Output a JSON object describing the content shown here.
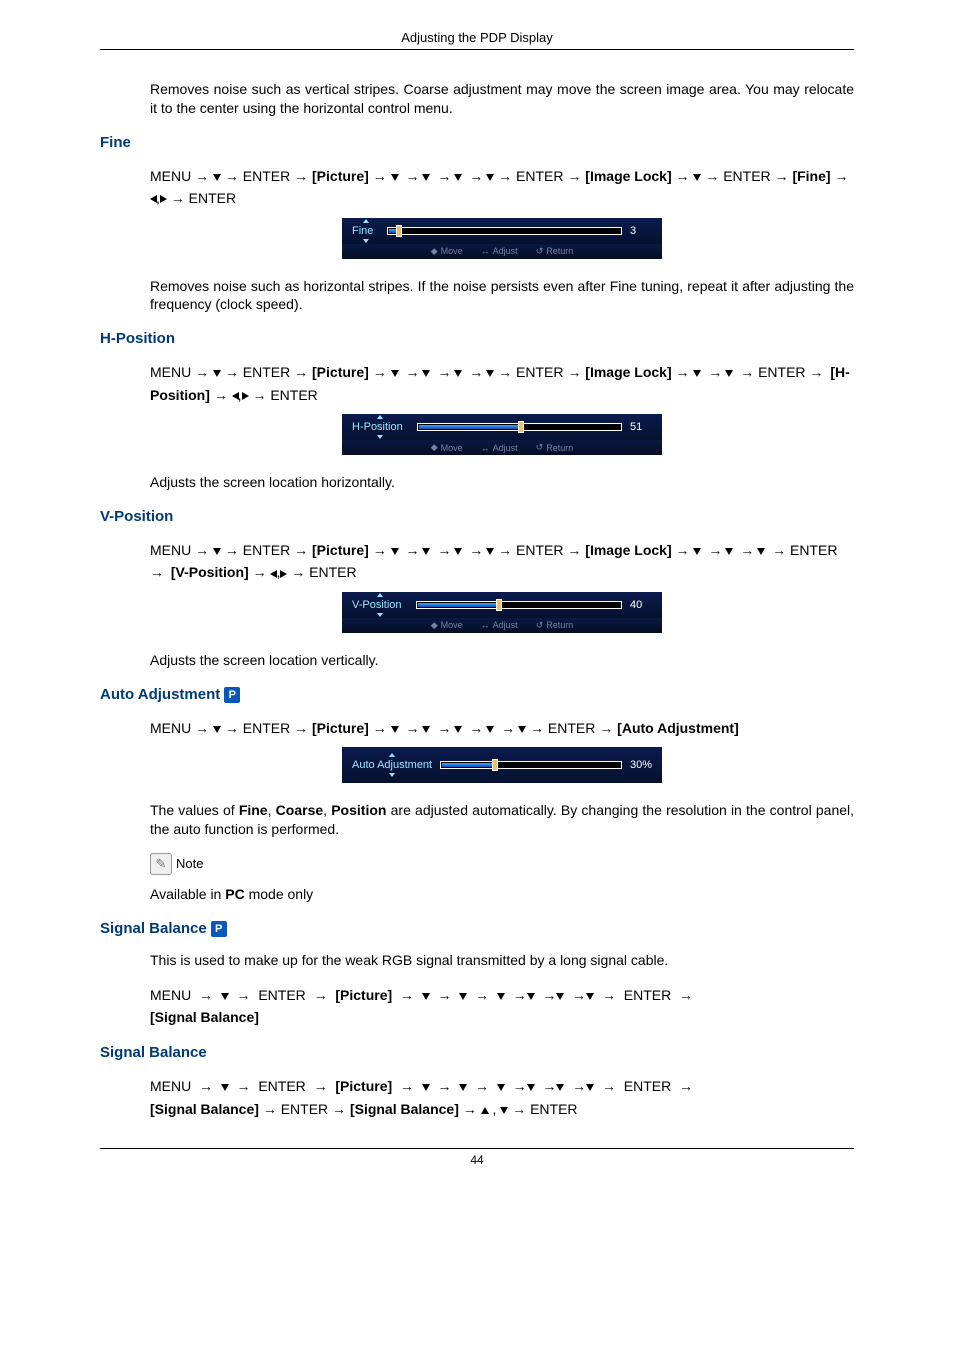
{
  "header": "Adjusting the PDP Display",
  "intro_para": "Removes noise such as vertical stripes. Coarse adjustment may move the screen image area. You may relocate it to the center using the horizontal control menu.",
  "sections": {
    "fine": {
      "title": "Fine",
      "nav_a": "MENU → ",
      "nav_b": " → ENTER → ",
      "bracket_picture": "[Picture]",
      "nav_c": " → ",
      "nav_d": " → ENTER → ",
      "bracket_imagelock": "[Image Lock]",
      "nav_e": " → ",
      "nav_f": " → ENTER → ",
      "bracket_fine": "[Fine]",
      "nav_g": " → ",
      "nav_h": " → ENTER",
      "osd_label": "Fine",
      "osd_value": "3",
      "desc": "Removes noise such as horizontal stripes. If the noise persists even after Fine tuning, repeat it after adjusting the frequency (clock speed)."
    },
    "hpos": {
      "title": "H-Position",
      "bracket_hpos": "[H-Position]",
      "osd_label": "H-Position",
      "osd_value": "51",
      "desc": "Adjusts the screen location horizontally."
    },
    "vpos": {
      "title": "V-Position",
      "bracket_vpos": "[V-Position]",
      "osd_label": "V-Position",
      "osd_value": "40",
      "desc": "Adjusts the screen location vertically."
    },
    "auto": {
      "title": "Auto Adjustment",
      "bracket_auto": "[Auto Adjustment]",
      "osd_label": "Auto Adjustment",
      "osd_value": "30%",
      "desc_a": "The values of ",
      "desc_b1": "Fine",
      "desc_b2": "Coarse",
      "desc_b3": "Position",
      "desc_c": " are adjusted automatically. By changing the resolution in the control panel, the auto function is performed.",
      "note_label": "Note",
      "note_body_a": "Available in ",
      "note_body_b": "PC",
      "note_body_c": " mode only"
    },
    "sigbal_intro": {
      "title": "Signal Balance",
      "desc": "This is used to make up for the weak RGB signal transmitted by a long signal cable.",
      "bracket_sb": "[Signal Balance]"
    },
    "sigbal": {
      "title": "Signal Balance"
    }
  },
  "osd_footer": {
    "move": "Move",
    "adjust": "Adjust",
    "ret": "Return"
  },
  "pc_badge": "P",
  "page_number": "44"
}
